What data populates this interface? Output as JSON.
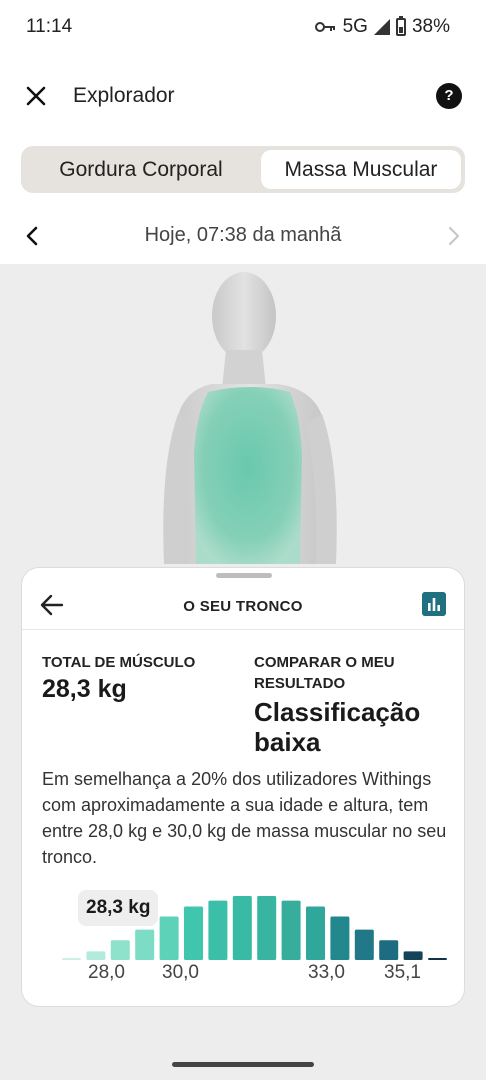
{
  "status_bar": {
    "time": "11:14",
    "network": "5G",
    "battery": "38%"
  },
  "header": {
    "title": "Explorador",
    "help_label": "?"
  },
  "tabs": [
    {
      "label": "Gordura Corporal",
      "selected": false
    },
    {
      "label": "Massa Muscular",
      "selected": true
    }
  ],
  "date_nav": {
    "label": "Hoje, 07:38 da manhã"
  },
  "sheet": {
    "title": "O SEU TRONCO",
    "total_label": "TOTAL DE MÚSCULO",
    "total_value": "28,3 kg",
    "compare_label": "COMPARAR O MEU RESULTADO",
    "classification": "Classificação baixa",
    "description": "Em semelhança a 20% dos utilizadores Withings com aproximadamente a sua idade e altura, tem entre 28,0 kg e 30,0 kg de massa muscular no seu tronco."
  },
  "chart_data": {
    "type": "bar",
    "title": "",
    "xlabel": "",
    "ylabel": "",
    "tick_labels": [
      "28,0",
      "30,0",
      "33,0",
      "35,1"
    ],
    "callout": "28,3 kg",
    "relative_heights": [
      0.03,
      0.13,
      0.3,
      0.46,
      0.66,
      0.81,
      0.9,
      0.97,
      0.97,
      0.9,
      0.81,
      0.66,
      0.46,
      0.3,
      0.13,
      0.03
    ],
    "colors": [
      "#cdf0e6",
      "#b2eadb",
      "#8ee2cc",
      "#7ddcc5",
      "#5dd2b8",
      "#3fc6ac",
      "#3bbfa8",
      "#38baa4",
      "#37b5a1",
      "#37ad9c",
      "#2fa79a",
      "#23888e",
      "#207889",
      "#1d6c82",
      "#14435a",
      "#0e3349"
    ],
    "user_bar_index": 2
  },
  "colors": {
    "accent": "#1f7180",
    "body_muscle": "#7ecfb5"
  }
}
